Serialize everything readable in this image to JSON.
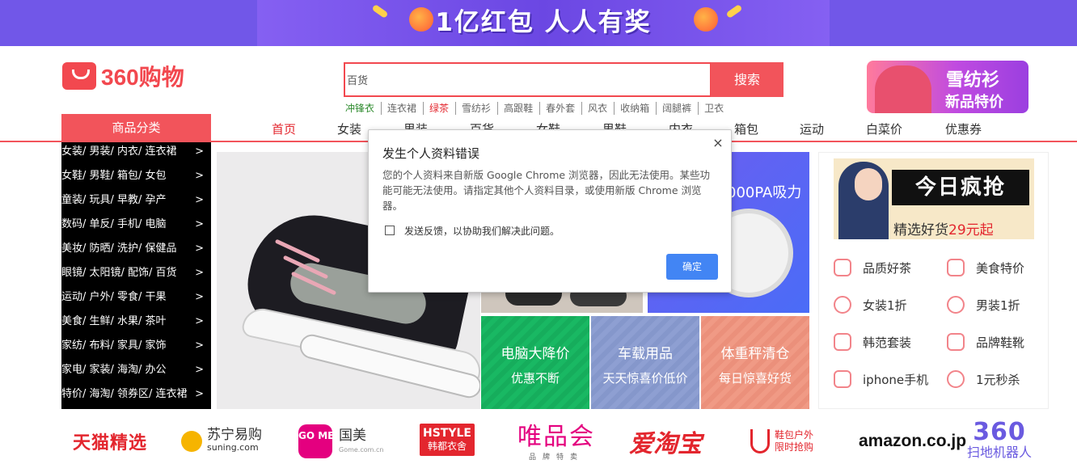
{
  "banner": {
    "text": "1亿红包 人人有奖",
    "background": "#7157e8"
  },
  "logo": {
    "text": "360购物",
    "color": "#f2484f"
  },
  "search": {
    "value": "百货",
    "button_label": "搜索",
    "hot_words": [
      {
        "label": "冲锋衣",
        "color": "#2e8b2e"
      },
      {
        "label": "连衣裙",
        "color": "#666666"
      },
      {
        "label": "绿茶",
        "color": "#e3262e"
      },
      {
        "label": "雪纺衫",
        "color": "#666666"
      },
      {
        "label": "高跟鞋",
        "color": "#666666"
      },
      {
        "label": "春外套",
        "color": "#666666"
      },
      {
        "label": "风衣",
        "color": "#666666"
      },
      {
        "label": "收纳箱",
        "color": "#666666"
      },
      {
        "label": "阔腿裤",
        "color": "#666666"
      },
      {
        "label": "卫衣",
        "color": "#666666"
      }
    ]
  },
  "promo_top": {
    "line1": "雪纺衫",
    "line2": "新品特价"
  },
  "nav": {
    "category_title": "商品分类",
    "items": [
      "首页",
      "女装",
      "男装",
      "百货",
      "女鞋",
      "男鞋",
      "内衣",
      "箱包",
      "运动",
      "白菜价",
      "优惠券"
    ],
    "active_index": 0,
    "accent": "#f2545b"
  },
  "categories": [
    "女装/ 男装/ 内衣/ 连衣裙",
    "女鞋/ 男鞋/ 箱包/ 女包",
    "童装/ 玩具/ 早教/ 孕产",
    "数码/ 单反/ 手机/ 电脑",
    "美妆/ 防晒/ 洗护/ 保健品",
    "眼镜/ 太阳镜/ 配饰/ 百货",
    "运动/ 户外/ 零食/ 干果",
    "美食/ 生鲜/ 水果/ 茶叶",
    "家纺/ 布料/ 家具/ 家饰",
    "家电/ 家装/ 海淘/ 办公",
    "特价/ 海淘/ 领券区/ 连衣裙"
  ],
  "category_arrow": ">",
  "robot_tile": {
    "text": "000PA吸力"
  },
  "tiles": [
    {
      "title": "电脑大降价",
      "subtitle": "优惠不断"
    },
    {
      "title": "车载用品",
      "subtitle": "天天惊喜价低价"
    },
    {
      "title": "体重秤清仓",
      "subtitle": "每日惊喜好货"
    }
  ],
  "today": {
    "title": "今日疯抢",
    "sub_prefix": "精选好货",
    "sub_price": "29元起"
  },
  "quick_links": [
    {
      "label": "品质好茶",
      "icon": "tea-cup-icon"
    },
    {
      "label": "美食特价",
      "icon": "gift-icon"
    },
    {
      "label": "女装1折",
      "icon": "dress-icon"
    },
    {
      "label": "男装1折",
      "icon": "shirt-icon"
    },
    {
      "label": "韩范套装",
      "icon": "hanger-icon"
    },
    {
      "label": "品牌鞋靴",
      "icon": "boot-icon"
    },
    {
      "label": "iphone手机",
      "icon": "phone-icon"
    },
    {
      "label": "1元秒杀",
      "icon": "clock-icon"
    }
  ],
  "brands": {
    "tmall": "天猫精选",
    "suning_cn": "苏宁易购",
    "suning_en": "suning.com",
    "gome_box": "GO ME",
    "gome_cn": "国美",
    "gome_en": "Gome.com.cn",
    "hstyle_en": "HSTYLE",
    "hstyle_cn": "韩都衣舍",
    "vip": "唯品会",
    "vip_sub": "品牌特卖",
    "aitaobao": "爱淘宝",
    "xiebao_line1": "鞋包户外",
    "xiebao_line2": "限时抢购",
    "amazon": "amazon.co.jp",
    "robot_360": "360",
    "robot_360_sub": "扫地机器人"
  },
  "dialog": {
    "title": "发生个人资料错误",
    "close": "×",
    "body": "您的个人资料来自新版 Google Chrome 浏览器，因此无法使用。某些功能可能无法使用。请指定其他个人资料目录，或使用新版 Chrome 浏览器。",
    "checkbox_label": "发送反馈，以协助我们解决此问题。",
    "ok_label": "确定",
    "ok_color": "#4285f4"
  }
}
